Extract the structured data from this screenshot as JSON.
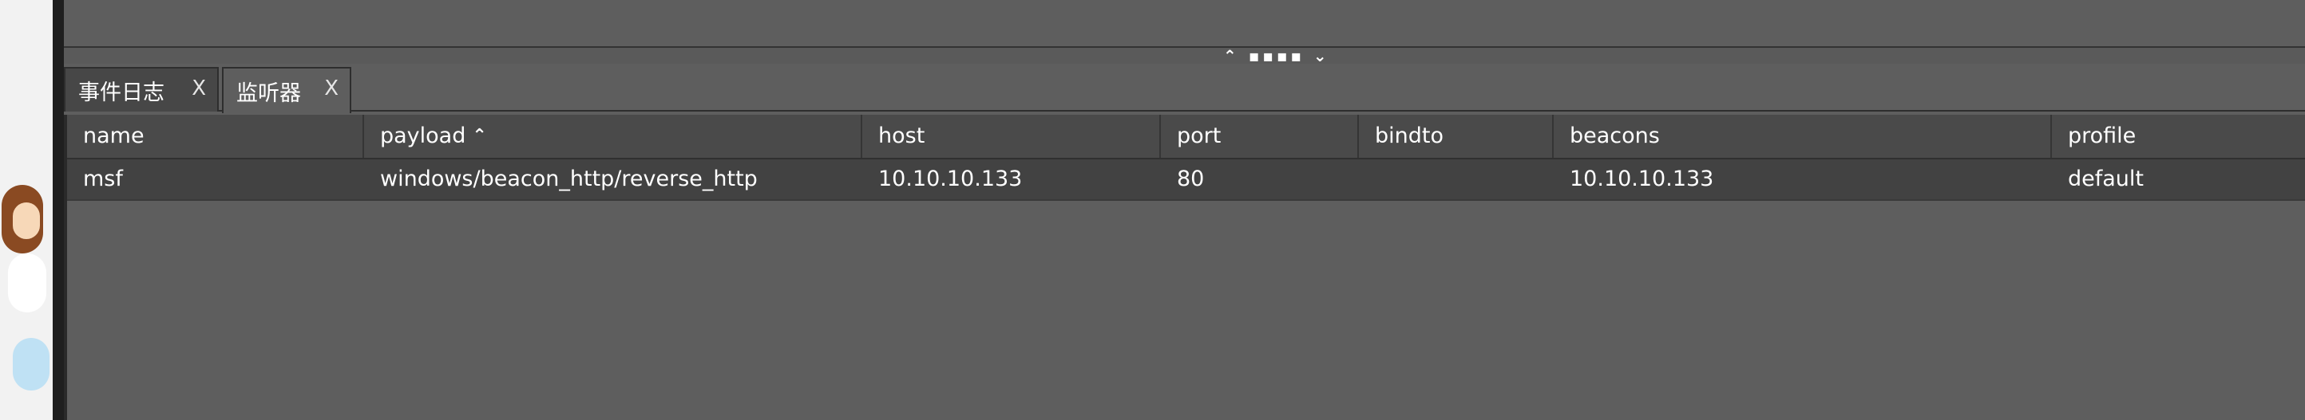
{
  "tabs": [
    {
      "label": "事件日志",
      "close": "X"
    },
    {
      "label": "监听器",
      "close": "X"
    }
  ],
  "splitter": {
    "grip": "⌃ ▪▪▪▪ ⌄"
  },
  "table": {
    "columns": [
      "name",
      "payload",
      "host",
      "port",
      "bindto",
      "beacons",
      "profile"
    ],
    "sort_icon": "sort-ascending-icon",
    "sort_glyph": "⌃",
    "rows": [
      [
        "msf",
        "windows/beacon_http/reverse_http",
        "10.10.10.133",
        "80",
        "",
        "10.10.10.133",
        "default"
      ]
    ]
  }
}
